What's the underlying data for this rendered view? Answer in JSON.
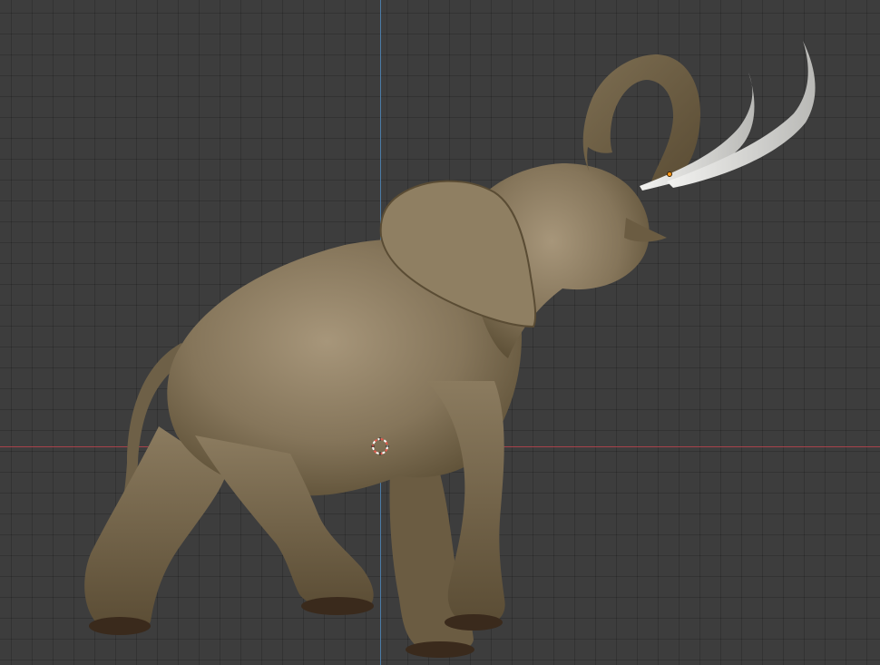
{
  "viewport": {
    "background_color": "#3d3d3d",
    "grid_color": "#2f2f2f",
    "x_axis_color": "#a8424b",
    "y_axis_color": "#4c7ba6"
  },
  "scene": {
    "object": "elephant",
    "object_icon": "elephant-model",
    "body_color": "#8a7a5c",
    "body_shadow_color": "#4e4330",
    "tusk_color": "#d9d9d6",
    "origin_color": "#ff9a1a"
  },
  "cursor": {
    "icon": "3d-cursor-icon",
    "ring_colors": [
      "#e05a4e",
      "#ffffff"
    ]
  }
}
